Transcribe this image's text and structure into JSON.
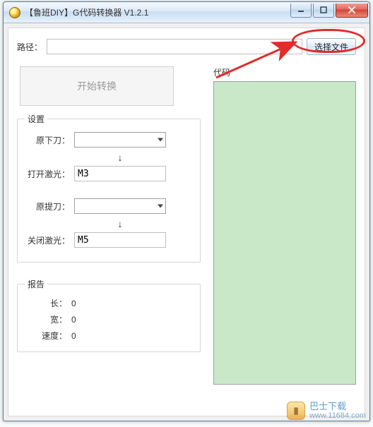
{
  "window": {
    "title": "【鲁班DIY】G代码转换器 V1.2.1"
  },
  "path": {
    "label": "路径：",
    "value": "",
    "choose_button": "选择文件"
  },
  "start_button": "开始转换",
  "settings": {
    "group_title": "设置",
    "down_tool_label": "原下刀：",
    "down_tool_value": "",
    "laser_on_label": "打开激光：",
    "laser_on_value": "M3",
    "up_tool_label": "原提刀：",
    "up_tool_value": "",
    "laser_off_label": "关闭激光：",
    "laser_off_value": "M5",
    "arrow_glyph": "↓"
  },
  "report": {
    "group_title": "报告",
    "length_label": "长：",
    "length_value": "0",
    "width_label": "宽：",
    "width_value": "0",
    "speed_label": "速度：",
    "speed_value": "0"
  },
  "code": {
    "label": "代码"
  },
  "watermark": {
    "main": "巴士下载",
    "sub": "www.11684.com"
  }
}
